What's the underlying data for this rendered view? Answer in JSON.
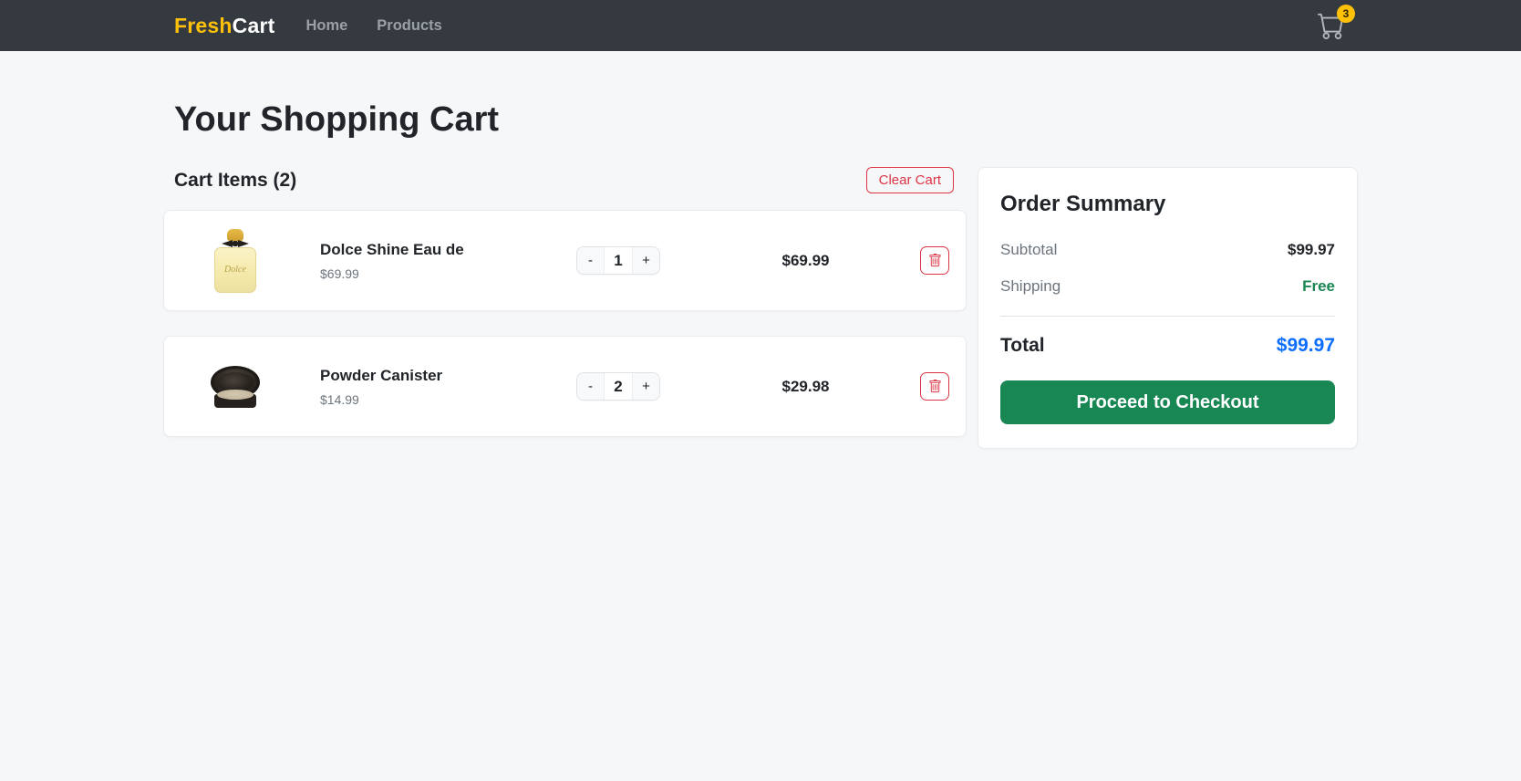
{
  "navbar": {
    "brand_accent": "Fresh",
    "brand_rest": "Cart",
    "links": [
      {
        "label": "Home"
      },
      {
        "label": "Products"
      }
    ],
    "cart_badge": "3"
  },
  "page": {
    "title": "Your Shopping Cart"
  },
  "cart": {
    "header": "Cart Items (2)",
    "clear_label": "Clear Cart",
    "items": [
      {
        "name": "Dolce Shine Eau de",
        "unit_price": "$69.99",
        "qty": "1",
        "line_total": "$69.99",
        "minus_label": "-",
        "plus_label": "+",
        "image": "perfume-bottle",
        "image_label": "Dolce"
      },
      {
        "name": "Powder Canister",
        "unit_price": "$14.99",
        "qty": "2",
        "line_total": "$29.98",
        "minus_label": "-",
        "plus_label": "+",
        "image": "powder-compact"
      }
    ]
  },
  "summary": {
    "title": "Order Summary",
    "rows": [
      {
        "label": "Subtotal",
        "value": "$99.97"
      },
      {
        "label": "Shipping",
        "value": "Free"
      }
    ],
    "total_label": "Total",
    "total_value": "$99.97",
    "checkout_label": "Proceed to Checkout"
  },
  "colors": {
    "brand_accent": "#ffc107",
    "navbar_bg": "#343a40",
    "danger": "#dc3545",
    "success": "#198754",
    "total_blue": "#0d6efd",
    "badge_bg": "#ffc107",
    "page_bg": "#f6f7f9"
  }
}
